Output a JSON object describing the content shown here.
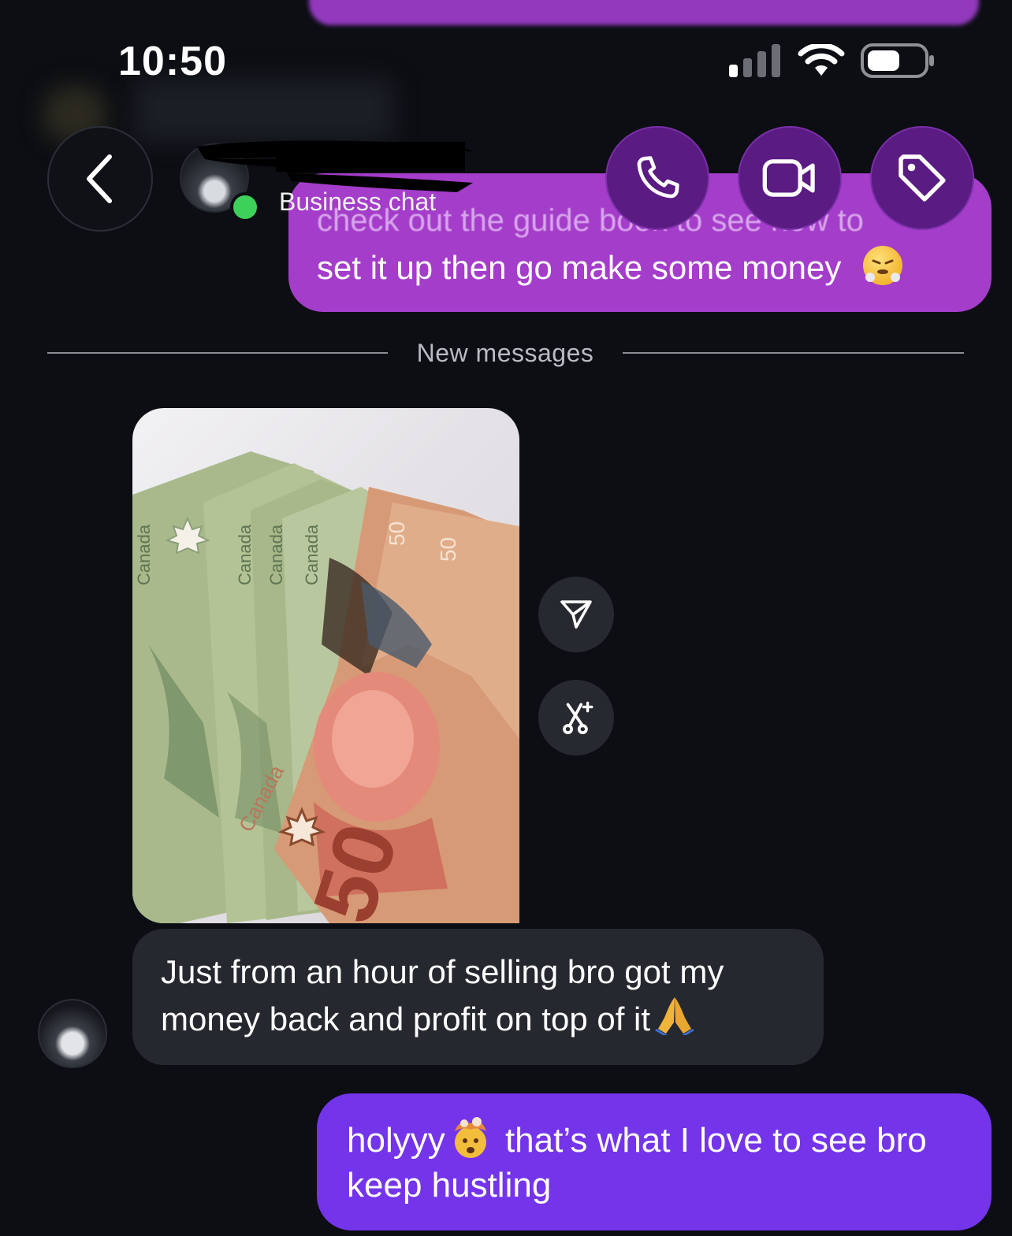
{
  "status_bar": {
    "time": "10:50",
    "icons": [
      "cellular-signal-icon",
      "wifi-icon",
      "battery-icon"
    ]
  },
  "header": {
    "back_icon": "chevron-left-icon",
    "contact_subtitle": "Business chat",
    "online": true,
    "actions": [
      "phone-icon",
      "video-camera-icon",
      "tag-icon"
    ]
  },
  "thread": {
    "previous_outgoing": {
      "partial_line": "check out the guide book to see how to",
      "line": "set it up then go make some money",
      "emoji": "face-with-steam-from-nose"
    },
    "divider_label": "New messages",
    "photo_message": {
      "image": "canadian-50-dollar-banknotes-photo",
      "banknote_text": "Canada",
      "banknote_value": "50",
      "side_actions": [
        "share-icon",
        "remix-icon"
      ]
    },
    "incoming_text": {
      "line1": "Just from an hour of selling bro got my",
      "line2": "money back and profit on top of it",
      "emoji": "folded-hands"
    },
    "outgoing_reply": {
      "word1": "holyyy",
      "emoji": "exploding-head",
      "rest_line1": " that’s what I love to see bro",
      "line2": "keep hustling"
    }
  },
  "colors": {
    "background": "#0c0e13",
    "outgoing_purple": "#a43dc9",
    "reply_violet": "#7434ea",
    "incoming_gray": "#25282e",
    "action_button": "#5a1b83",
    "online_green": "#3dd15a"
  }
}
